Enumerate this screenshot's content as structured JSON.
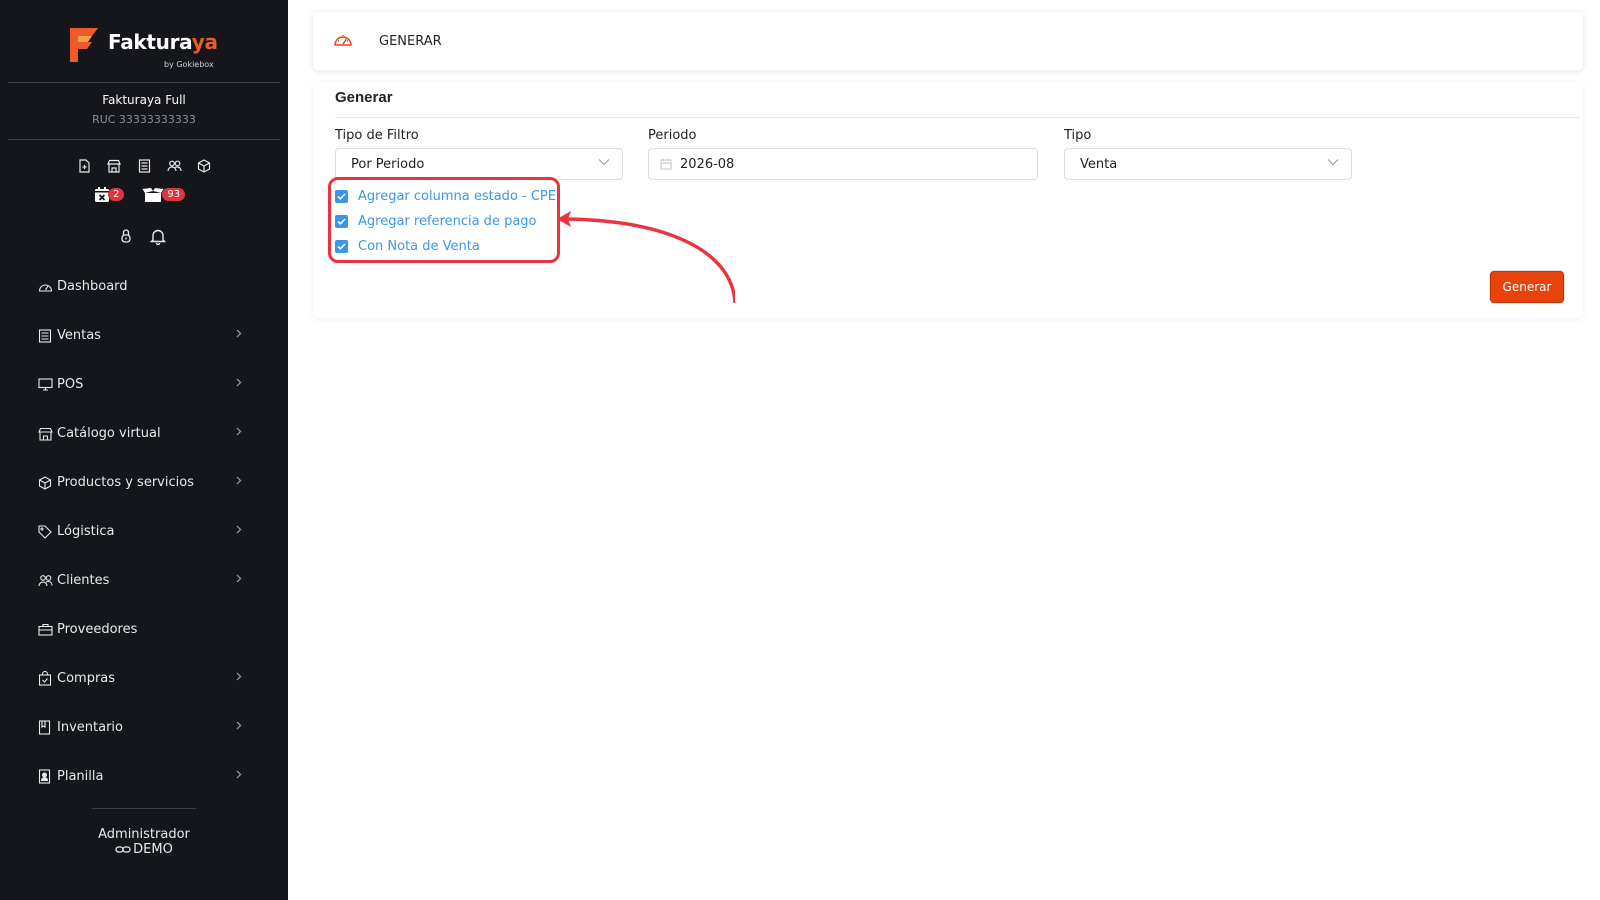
{
  "brand": {
    "name_part1": "Faktura",
    "name_part2": "ya",
    "subtitle": "by Gokiebox",
    "accent": "#f05a28"
  },
  "company": {
    "name": "Fakturaya Full",
    "ruc": "RUC 33333333333"
  },
  "quick_icons": [
    "document-add-icon",
    "store-icon",
    "receipt-icon",
    "users-icon",
    "box-icon"
  ],
  "badges": {
    "calendar": "2",
    "packages": "93"
  },
  "user_icons": [
    "lock-icon",
    "bell-icon"
  ],
  "menu": [
    {
      "label": "Dashboard",
      "icon": "dashboard-icon",
      "has_children": false
    },
    {
      "label": "Ventas",
      "icon": "receipt-icon",
      "has_children": true
    },
    {
      "label": "POS",
      "icon": "monitor-icon",
      "has_children": true
    },
    {
      "label": "Catálogo virtual",
      "icon": "store-icon",
      "has_children": true
    },
    {
      "label": "Productos y servicios",
      "icon": "box-icon",
      "has_children": true
    },
    {
      "label": "Lógistica",
      "icon": "tag-icon",
      "has_children": true
    },
    {
      "label": "Clientes",
      "icon": "users-icon",
      "has_children": true
    },
    {
      "label": "Proveedores",
      "icon": "briefcase-icon",
      "has_children": false
    },
    {
      "label": "Compras",
      "icon": "shopping-bag-icon",
      "has_children": true
    },
    {
      "label": "Inventario",
      "icon": "book-icon",
      "has_children": true
    },
    {
      "label": "Planilla",
      "icon": "id-card-icon",
      "has_children": true
    }
  ],
  "footer": {
    "role": "Administrador",
    "user": "DEMO"
  },
  "header": {
    "title": "GENERAR"
  },
  "card": {
    "title": "Generar",
    "filter_type": {
      "label": "Tipo de Filtro",
      "value": "Por Periodo"
    },
    "period": {
      "label": "Periodo",
      "value": "2026-08"
    },
    "type": {
      "label": "Tipo",
      "value": "Venta"
    },
    "checkboxes": [
      {
        "label": "Agregar columna estado - CPE",
        "checked": true
      },
      {
        "label": "Agregar referencia de pago",
        "checked": true
      },
      {
        "label": "Con Nota de Venta",
        "checked": true
      }
    ],
    "button": "Generar"
  },
  "colors": {
    "sidebar_bg": "#14161b",
    "primary_button": "#e8420d",
    "checkbox": "#3a97e8",
    "annotation": "#e8343f"
  }
}
